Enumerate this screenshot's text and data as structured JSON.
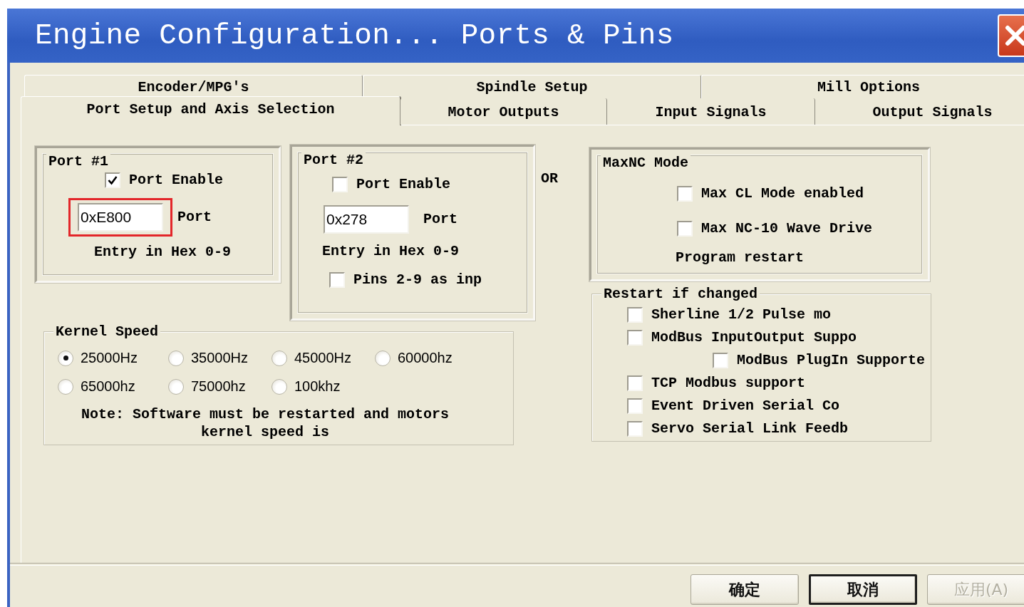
{
  "window": {
    "title": "Engine Configuration... Ports & Pins"
  },
  "tab_rows": [
    [
      {
        "label": "Encoder/MPG's",
        "selected": false
      },
      {
        "label": "Spindle Setup",
        "selected": false
      },
      {
        "label": "Mill Options",
        "selected": false
      }
    ],
    [
      {
        "label": "Port Setup and Axis Selection",
        "selected": true
      },
      {
        "label": "Motor Outputs",
        "selected": false
      },
      {
        "label": "Input Signals",
        "selected": false
      },
      {
        "label": "Output Signals",
        "selected": false
      }
    ]
  ],
  "port_1": {
    "title": "Port #1",
    "enable": {
      "label": "Port Enable",
      "checked": true
    },
    "highlighted": true,
    "address": "0xE800",
    "address_label": "Port",
    "hint": "Entry in Hex 0-9"
  },
  "port_2": {
    "title": "Port #2",
    "enable": {
      "label": "Port Enable",
      "checked": false
    },
    "address": "0x278",
    "address_label": "Port",
    "hint": "Entry in Hex 0-9",
    "pins_as_input": {
      "label": "Pins 2-9 as inp",
      "checked": false
    }
  },
  "or_label": "OR",
  "kernel_speed": {
    "title": "Kernel Speed",
    "options": [
      {
        "label": "25000Hz",
        "selected": true
      },
      {
        "label": "35000Hz",
        "selected": false
      },
      {
        "label": "45000Hz",
        "selected": false
      },
      {
        "label": "60000hz",
        "selected": false
      },
      {
        "label": "65000hz",
        "selected": false
      },
      {
        "label": "75000hz",
        "selected": false
      },
      {
        "label": "100khz",
        "selected": false
      }
    ],
    "note": "Note: Software must be restarted and motors\nkernel speed is"
  },
  "maxnc_mode": {
    "title": "MaxNC Mode",
    "options": [
      {
        "label": "Max CL Mode enabled",
        "checked": false
      },
      {
        "label": "Max NC-10 Wave Drive",
        "checked": false
      }
    ],
    "note": "Program restart"
  },
  "restart_if_changed": {
    "title": "Restart if changed",
    "options": [
      {
        "label": "Sherline 1/2 Pulse mo",
        "checked": false
      },
      {
        "label": "ModBus InputOutput Suppo",
        "checked": false,
        "children": [
          {
            "label": "ModBus PlugIn Supporte",
            "checked": false
          }
        ]
      },
      {
        "label": "TCP Modbus support",
        "checked": false
      },
      {
        "label": "Event Driven Serial Co",
        "checked": false
      },
      {
        "label": "Servo Serial Link Feedb",
        "checked": false
      }
    ]
  },
  "buttons": [
    {
      "label": "确定",
      "default": false,
      "disabled": false
    },
    {
      "label": "取消",
      "default": true,
      "disabled": false
    },
    {
      "label": "应用(A)",
      "default": false,
      "disabled": true
    }
  ]
}
